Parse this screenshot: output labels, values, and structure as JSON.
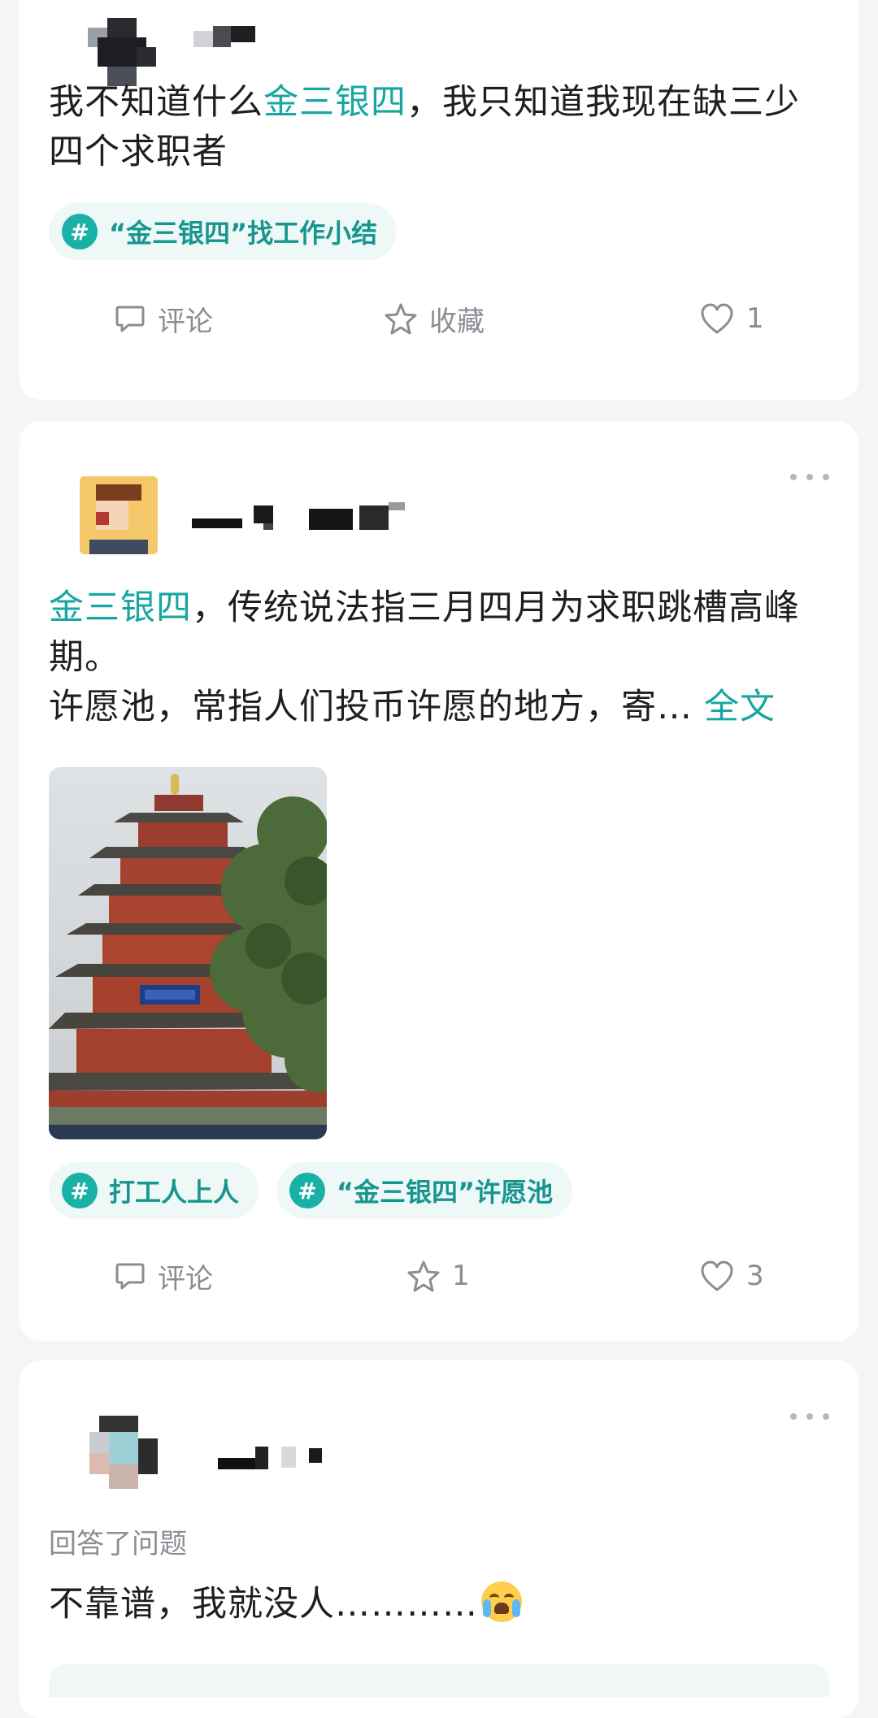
{
  "posts": [
    {
      "text_parts": [
        "我不知道什么",
        "金三银四",
        "，我只知道我现在缺三少四个求职者"
      ],
      "tags": [
        {
          "icon": "#",
          "label": "“金三银四”找工作小结"
        }
      ],
      "actions": {
        "comment": "评论",
        "favorite": "收藏",
        "like": "1"
      }
    },
    {
      "text_line1_kw": "金三银四",
      "text_line1": "，传统说法指三月四月为求职跳槽高峰期。",
      "text_line2": "许愿池，常指人们投币许愿的地方，寄…",
      "full_text_link": "全文",
      "image_label": "阅江楼 pagoda photo",
      "tags": [
        {
          "icon": "#",
          "label": "打工人上人"
        },
        {
          "icon": "#",
          "label": "“金三银四”许愿池"
        }
      ],
      "actions": {
        "comment": "评论",
        "favorite": "1",
        "like": "3"
      }
    },
    {
      "sub_label": "回答了问题",
      "text": "不靠谱，我就没人…………"
    }
  ],
  "colors": {
    "accent": "#17a6a0",
    "tag_bg": "#eef8f7",
    "muted": "#8a8d93"
  }
}
